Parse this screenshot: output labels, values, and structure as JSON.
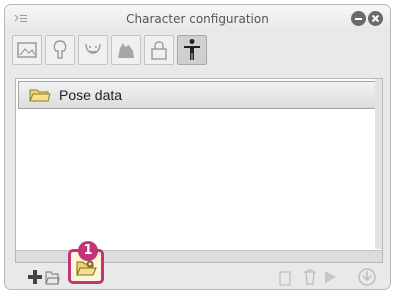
{
  "window": {
    "title": "Character configuration"
  },
  "tabs": [
    {
      "icon": "image-frame-icon"
    },
    {
      "icon": "tree-icon"
    },
    {
      "icon": "face-icon"
    },
    {
      "icon": "animal-icon"
    },
    {
      "icon": "lock-icon"
    },
    {
      "icon": "person-pose-icon",
      "active": true
    }
  ],
  "list": {
    "items": [
      {
        "label": "Pose data",
        "icon": "folder-icon"
      }
    ]
  },
  "callout": {
    "number": "1"
  },
  "colors": {
    "highlight": "#c0357a",
    "window_bg": "#e9e9e9"
  }
}
